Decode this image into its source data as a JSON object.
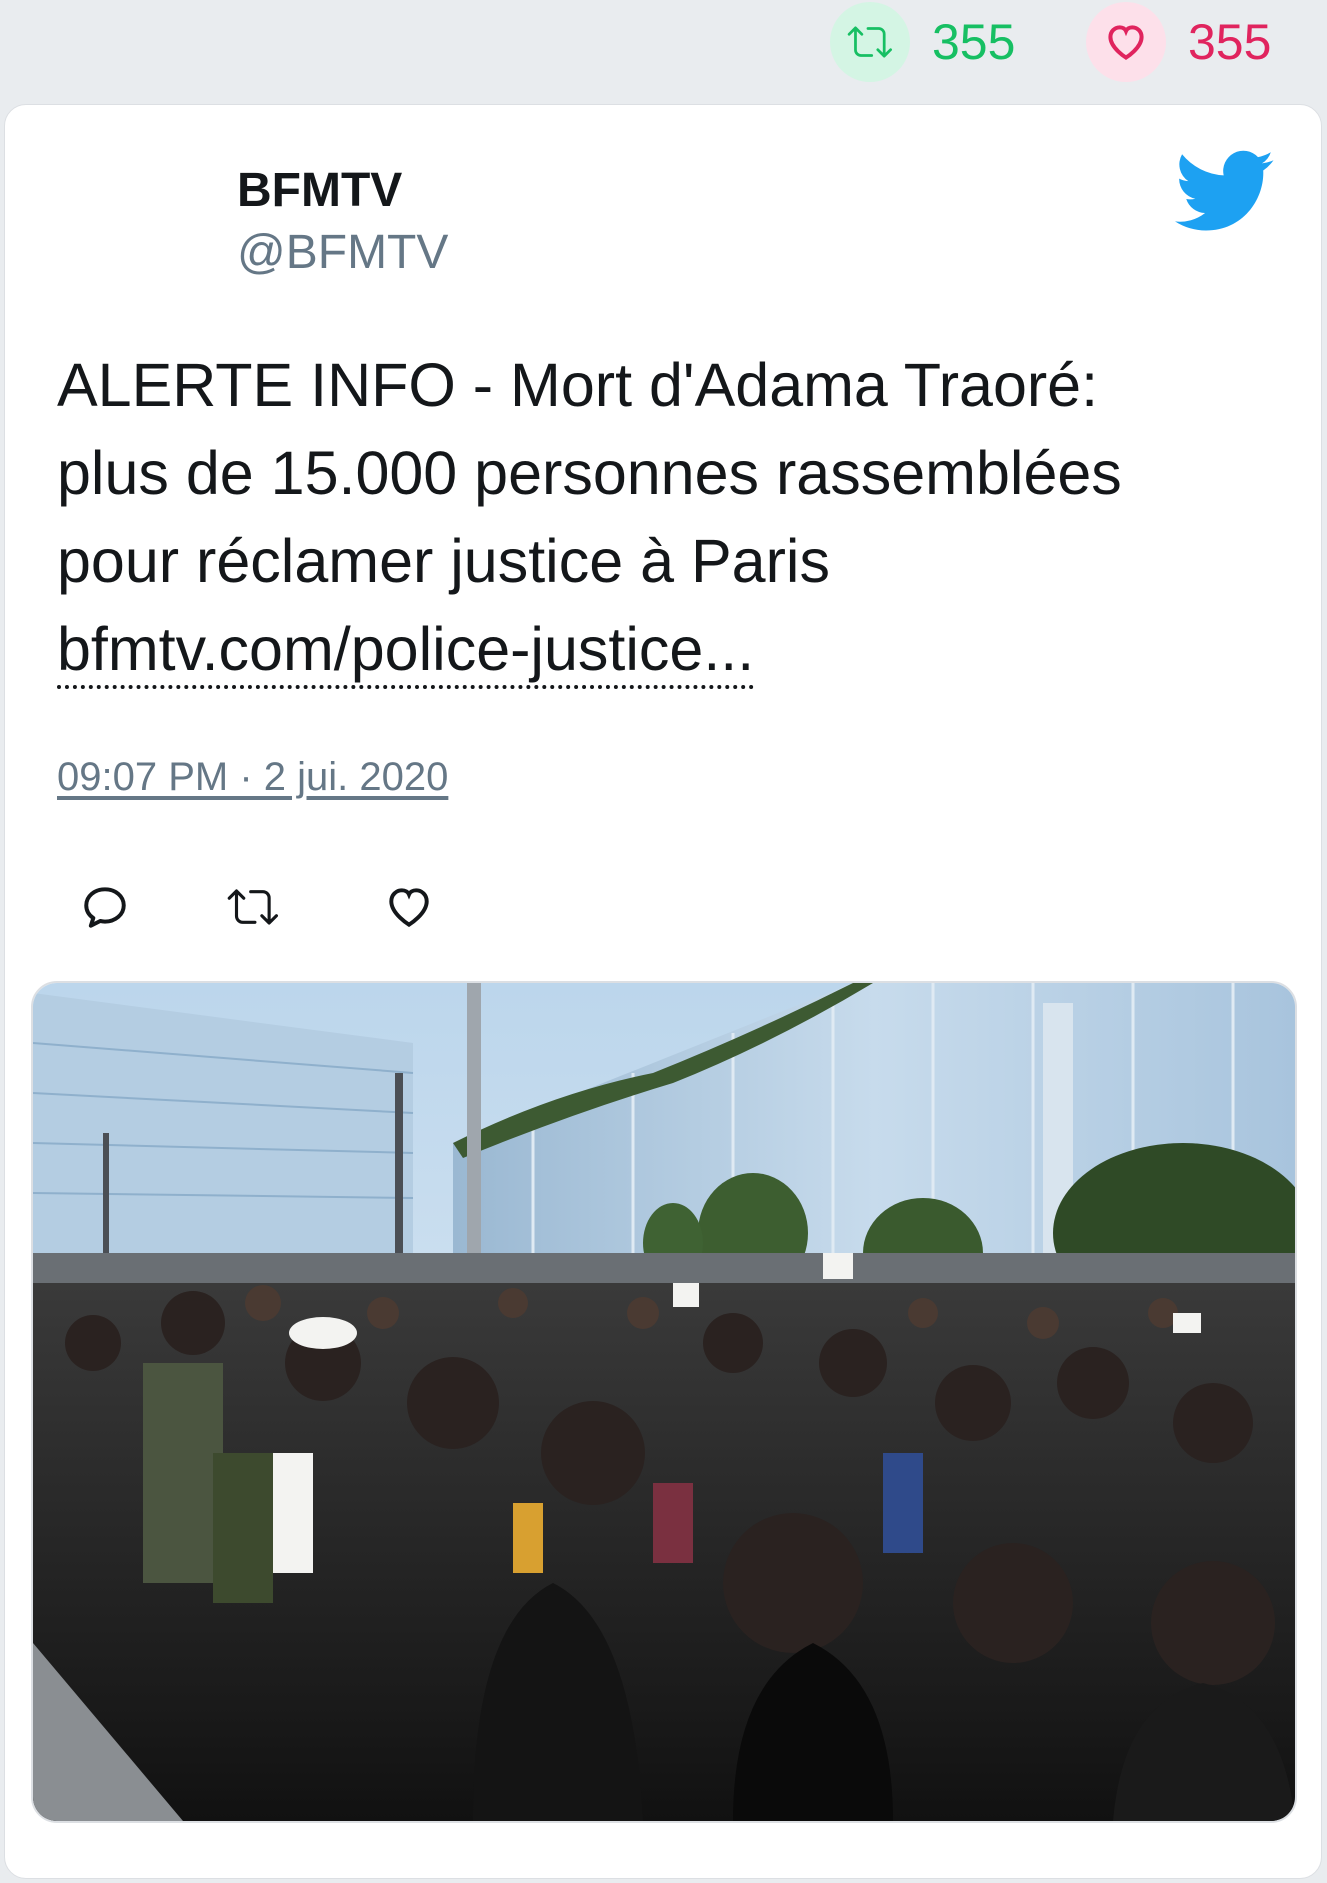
{
  "stats": {
    "retweets": "355",
    "likes": "355"
  },
  "tweet": {
    "author_name": "BFMTV",
    "author_handle": "@BFMTV",
    "text_lines": [
      "ALERTE INFO - Mort d'Adama Traoré:",
      "plus de 15.000 personnes rassemblées",
      "pour réclamer justice à Paris"
    ],
    "link_text": "bfmtv.com/police-justice...",
    "timestamp": "09:07 PM · 2 jui. 2020",
    "media_description_icon": "photo"
  },
  "icons": {
    "retweet_stat": "retweet-icon",
    "like_stat": "heart-icon",
    "twitter": "twitter-bird-icon",
    "reply": "reply-icon",
    "retweet": "retweet-icon",
    "like": "heart-icon"
  },
  "colors": {
    "retweet_green": "#17bf63",
    "like_pink": "#e0245e",
    "twitter_blue": "#1da1f2",
    "handle_gray": "#657786"
  }
}
